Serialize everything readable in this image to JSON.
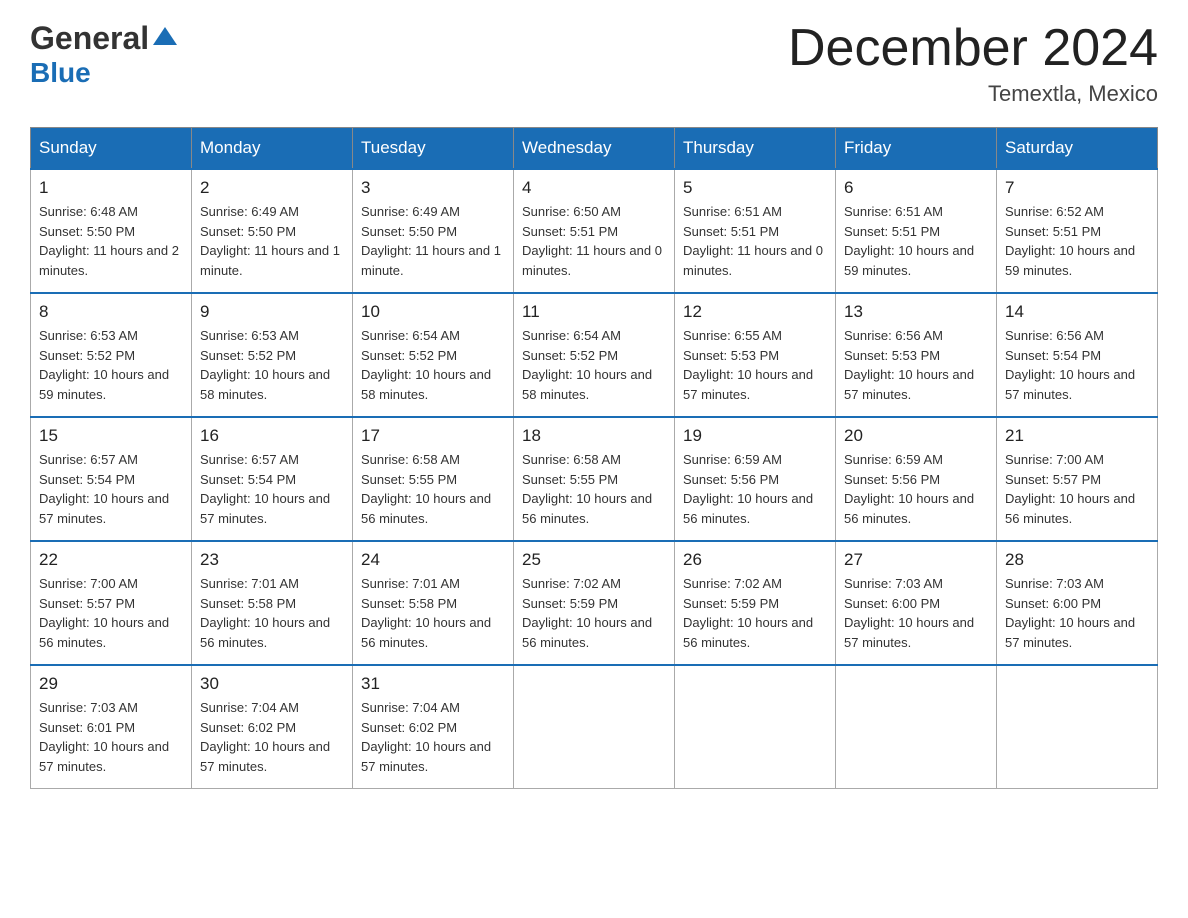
{
  "header": {
    "logo_general": "General",
    "logo_blue": "Blue",
    "month_title": "December 2024",
    "location": "Temextla, Mexico"
  },
  "weekdays": [
    "Sunday",
    "Monday",
    "Tuesday",
    "Wednesday",
    "Thursday",
    "Friday",
    "Saturday"
  ],
  "weeks": [
    [
      {
        "day": "1",
        "sunrise": "6:48 AM",
        "sunset": "5:50 PM",
        "daylight": "11 hours and 2 minutes."
      },
      {
        "day": "2",
        "sunrise": "6:49 AM",
        "sunset": "5:50 PM",
        "daylight": "11 hours and 1 minute."
      },
      {
        "day": "3",
        "sunrise": "6:49 AM",
        "sunset": "5:50 PM",
        "daylight": "11 hours and 1 minute."
      },
      {
        "day": "4",
        "sunrise": "6:50 AM",
        "sunset": "5:51 PM",
        "daylight": "11 hours and 0 minutes."
      },
      {
        "day": "5",
        "sunrise": "6:51 AM",
        "sunset": "5:51 PM",
        "daylight": "11 hours and 0 minutes."
      },
      {
        "day": "6",
        "sunrise": "6:51 AM",
        "sunset": "5:51 PM",
        "daylight": "10 hours and 59 minutes."
      },
      {
        "day": "7",
        "sunrise": "6:52 AM",
        "sunset": "5:51 PM",
        "daylight": "10 hours and 59 minutes."
      }
    ],
    [
      {
        "day": "8",
        "sunrise": "6:53 AM",
        "sunset": "5:52 PM",
        "daylight": "10 hours and 59 minutes."
      },
      {
        "day": "9",
        "sunrise": "6:53 AM",
        "sunset": "5:52 PM",
        "daylight": "10 hours and 58 minutes."
      },
      {
        "day": "10",
        "sunrise": "6:54 AM",
        "sunset": "5:52 PM",
        "daylight": "10 hours and 58 minutes."
      },
      {
        "day": "11",
        "sunrise": "6:54 AM",
        "sunset": "5:52 PM",
        "daylight": "10 hours and 58 minutes."
      },
      {
        "day": "12",
        "sunrise": "6:55 AM",
        "sunset": "5:53 PM",
        "daylight": "10 hours and 57 minutes."
      },
      {
        "day": "13",
        "sunrise": "6:56 AM",
        "sunset": "5:53 PM",
        "daylight": "10 hours and 57 minutes."
      },
      {
        "day": "14",
        "sunrise": "6:56 AM",
        "sunset": "5:54 PM",
        "daylight": "10 hours and 57 minutes."
      }
    ],
    [
      {
        "day": "15",
        "sunrise": "6:57 AM",
        "sunset": "5:54 PM",
        "daylight": "10 hours and 57 minutes."
      },
      {
        "day": "16",
        "sunrise": "6:57 AM",
        "sunset": "5:54 PM",
        "daylight": "10 hours and 57 minutes."
      },
      {
        "day": "17",
        "sunrise": "6:58 AM",
        "sunset": "5:55 PM",
        "daylight": "10 hours and 56 minutes."
      },
      {
        "day": "18",
        "sunrise": "6:58 AM",
        "sunset": "5:55 PM",
        "daylight": "10 hours and 56 minutes."
      },
      {
        "day": "19",
        "sunrise": "6:59 AM",
        "sunset": "5:56 PM",
        "daylight": "10 hours and 56 minutes."
      },
      {
        "day": "20",
        "sunrise": "6:59 AM",
        "sunset": "5:56 PM",
        "daylight": "10 hours and 56 minutes."
      },
      {
        "day": "21",
        "sunrise": "7:00 AM",
        "sunset": "5:57 PM",
        "daylight": "10 hours and 56 minutes."
      }
    ],
    [
      {
        "day": "22",
        "sunrise": "7:00 AM",
        "sunset": "5:57 PM",
        "daylight": "10 hours and 56 minutes."
      },
      {
        "day": "23",
        "sunrise": "7:01 AM",
        "sunset": "5:58 PM",
        "daylight": "10 hours and 56 minutes."
      },
      {
        "day": "24",
        "sunrise": "7:01 AM",
        "sunset": "5:58 PM",
        "daylight": "10 hours and 56 minutes."
      },
      {
        "day": "25",
        "sunrise": "7:02 AM",
        "sunset": "5:59 PM",
        "daylight": "10 hours and 56 minutes."
      },
      {
        "day": "26",
        "sunrise": "7:02 AM",
        "sunset": "5:59 PM",
        "daylight": "10 hours and 56 minutes."
      },
      {
        "day": "27",
        "sunrise": "7:03 AM",
        "sunset": "6:00 PM",
        "daylight": "10 hours and 57 minutes."
      },
      {
        "day": "28",
        "sunrise": "7:03 AM",
        "sunset": "6:00 PM",
        "daylight": "10 hours and 57 minutes."
      }
    ],
    [
      {
        "day": "29",
        "sunrise": "7:03 AM",
        "sunset": "6:01 PM",
        "daylight": "10 hours and 57 minutes."
      },
      {
        "day": "30",
        "sunrise": "7:04 AM",
        "sunset": "6:02 PM",
        "daylight": "10 hours and 57 minutes."
      },
      {
        "day": "31",
        "sunrise": "7:04 AM",
        "sunset": "6:02 PM",
        "daylight": "10 hours and 57 minutes."
      },
      null,
      null,
      null,
      null
    ]
  ]
}
